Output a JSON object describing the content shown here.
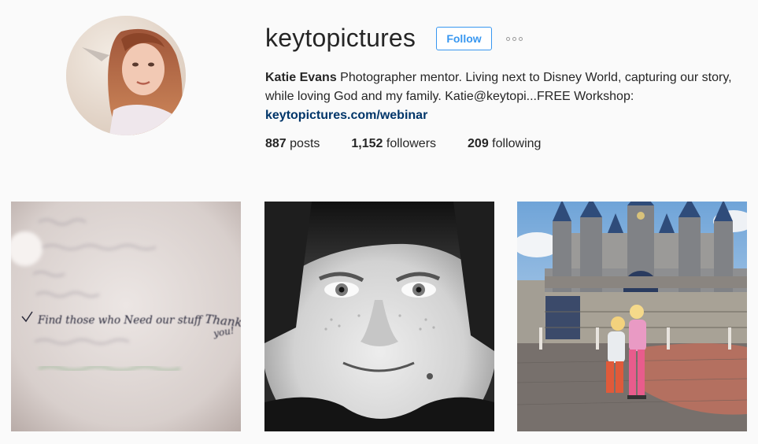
{
  "profile": {
    "username": "keytopictures",
    "follow_label": "Follow",
    "more_label": "...",
    "full_name": "Katie Evans",
    "bio_line": " Photographer mentor. Living next to Disney World, capturing our story, while loving God and my family. Katie@keytopi...FREE Workshop:",
    "website": "keytopictures.com/webinar"
  },
  "stats": {
    "posts_count": "887",
    "posts_label": " posts",
    "followers_count": "1,152",
    "followers_label": " followers",
    "following_count": "209",
    "following_label": " following"
  },
  "note_lines": [
    "Find those who Need our stuff",
    "Thank",
    "you!"
  ],
  "colors": {
    "follow_blue": "#3897f0",
    "link_blue": "#003569",
    "background": "#fafafa"
  }
}
